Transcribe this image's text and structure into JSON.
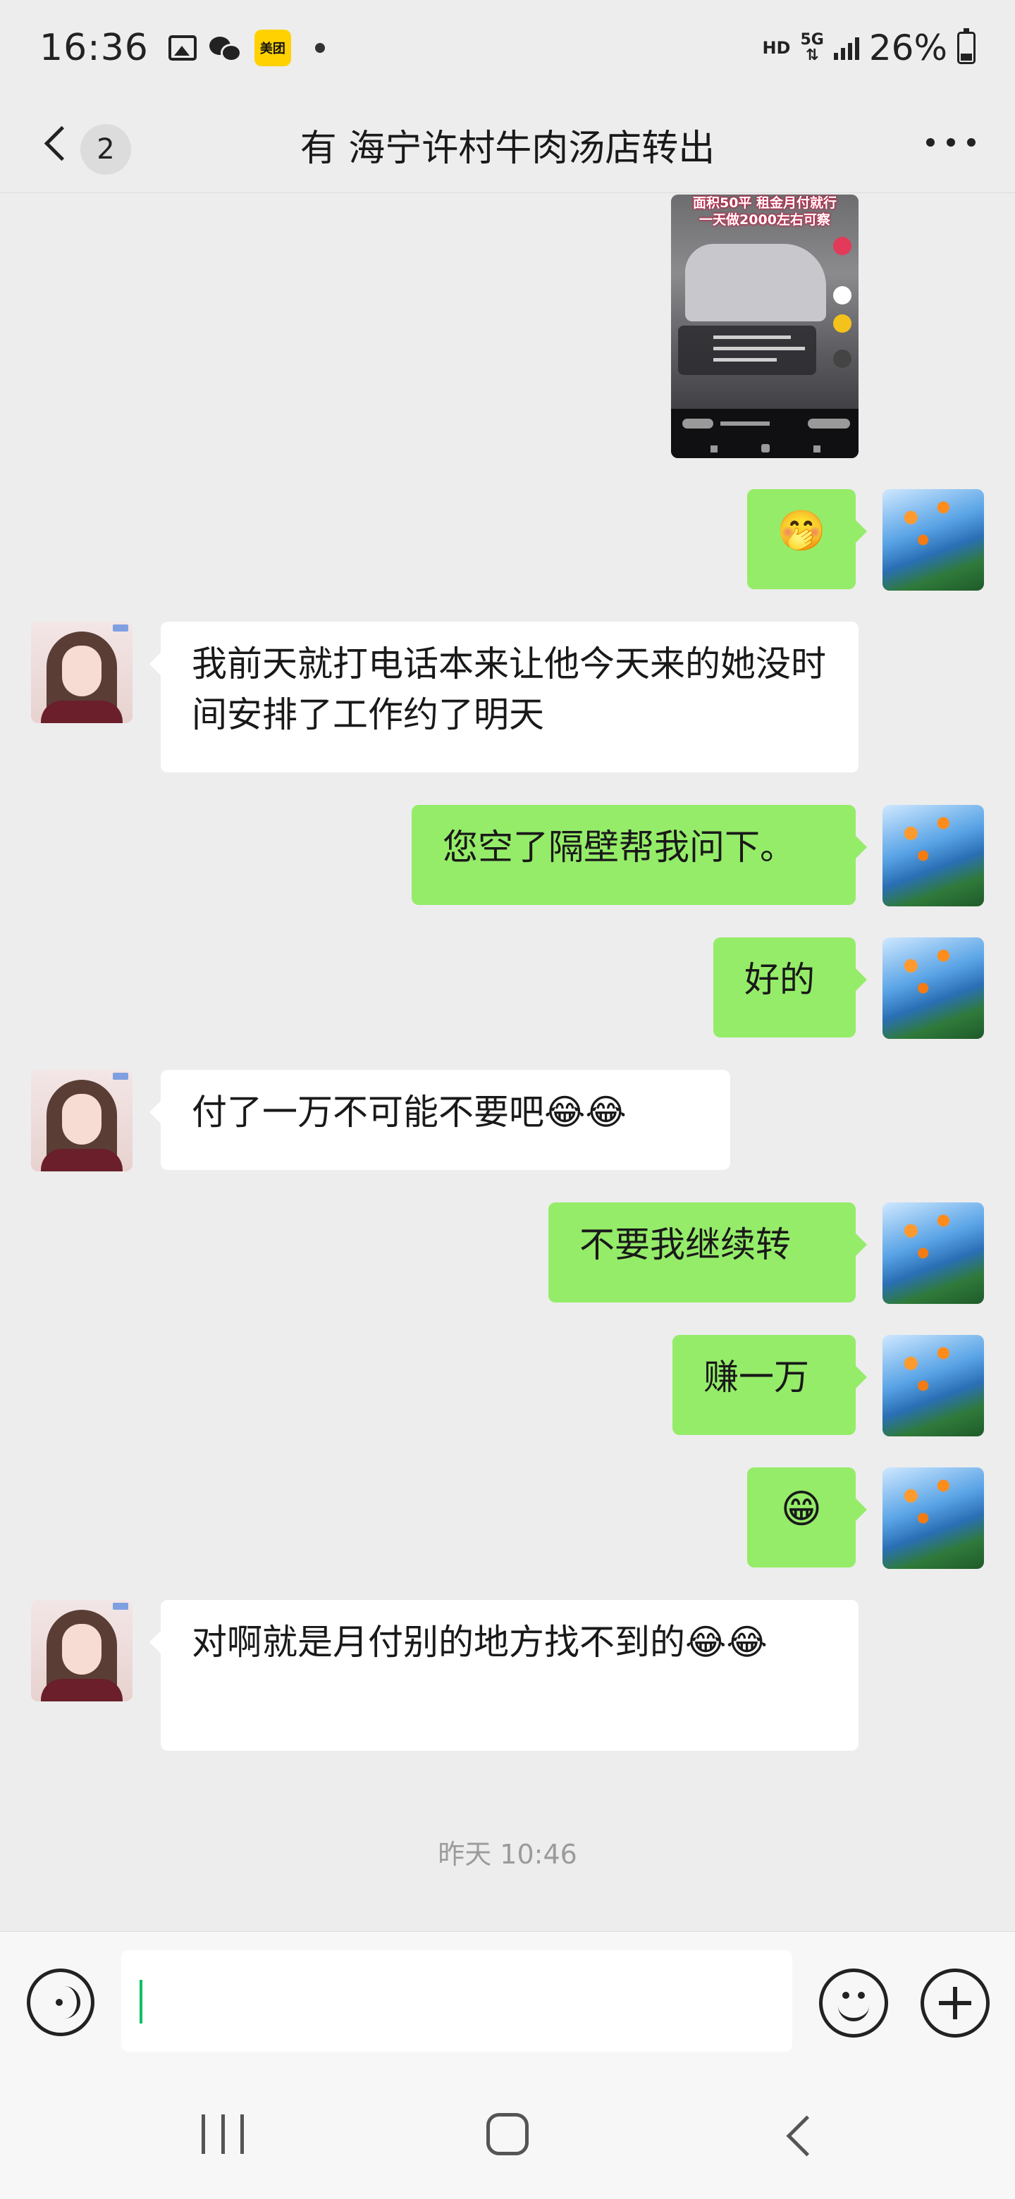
{
  "status_bar": {
    "time": "16:36",
    "meituan_label": "美团",
    "hd": "HD",
    "network": "5G",
    "battery": "26%"
  },
  "header": {
    "unread_count": "2",
    "title": "有 海宁许村牛肉汤店转出"
  },
  "video": {
    "caption_line1": "面积50平 租金月付就行",
    "caption_line2": "一天做2000左右可察"
  },
  "messages": [
    {
      "from": "me",
      "text": "🤭"
    },
    {
      "from": "other",
      "text": "我前天就打电话本来让他今天来的她没时间安排了工作约了明天"
    },
    {
      "from": "me",
      "text": "您空了隔壁帮我问下。"
    },
    {
      "from": "me",
      "text": "好的"
    },
    {
      "from": "other",
      "text": "付了一万不可能不要吧😂😂"
    },
    {
      "from": "me",
      "text": "不要我继续转"
    },
    {
      "from": "me",
      "text": "赚一万"
    },
    {
      "from": "me",
      "text": "😁"
    },
    {
      "from": "other",
      "text": "对啊就是月付别的地方找不到的😂😂"
    }
  ],
  "timestamp": "昨天 10:46",
  "input": {
    "value": ""
  },
  "icons": {
    "back": "back-chevron-icon",
    "more": "more-dots-icon",
    "voice": "voice-icon",
    "emoji": "emoji-icon",
    "plus": "plus-icon"
  },
  "colors": {
    "bubble_out": "#95ec69",
    "bubble_in": "#ffffff",
    "background": "#ededed",
    "caret": "#07c160"
  }
}
